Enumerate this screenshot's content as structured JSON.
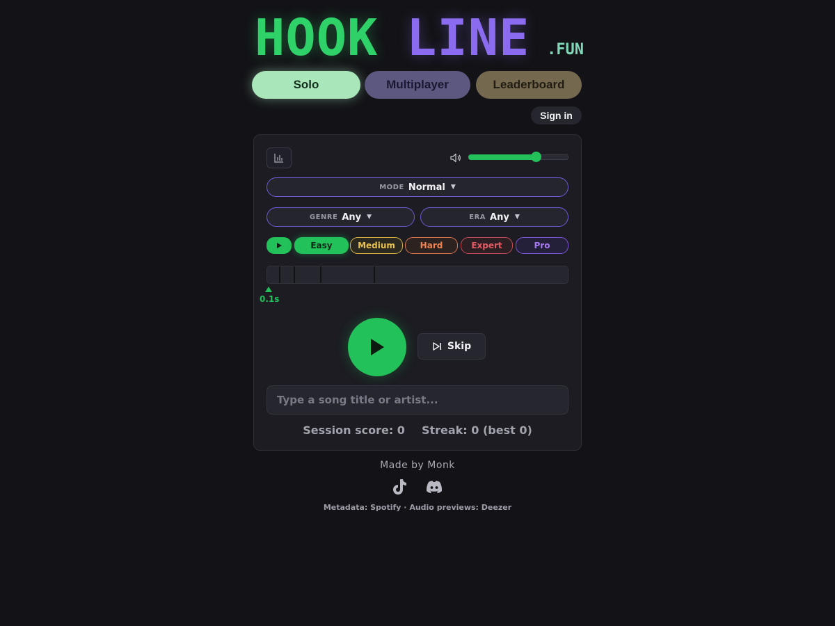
{
  "logo": {
    "part1": "HOOK",
    "part2": "LINE",
    "suffix": ".FUN"
  },
  "nav": {
    "solo": "Solo",
    "multiplayer": "Multiplayer",
    "leaderboard": "Leaderboard"
  },
  "auth": {
    "sign_in": "Sign in"
  },
  "player": {
    "stats_icon": "bar-chart-icon",
    "volume_icon": "speaker-icon",
    "volume_level": 0.68
  },
  "mode": {
    "label": "MODE",
    "value": "Normal"
  },
  "genre": {
    "label": "GENRE",
    "value": "Any"
  },
  "era": {
    "label": "ERA",
    "value": "Any"
  },
  "difficulty": {
    "preview_icon": "play-icon",
    "options": [
      "Easy",
      "Medium",
      "Hard",
      "Expert",
      "Pro"
    ],
    "selected": "Easy"
  },
  "timeline": {
    "marker_label": "0.1s",
    "segments_s": [
      0.1,
      0.5,
      2,
      8,
      16
    ]
  },
  "controls": {
    "play_icon": "play-icon",
    "skip_label": "Skip",
    "skip_icon": "skip-forward-icon"
  },
  "guess": {
    "placeholder": "Type a song title or artist..."
  },
  "score": {
    "session": "Session score: 0",
    "streak": "Streak: 0 (best 0)"
  },
  "footer": {
    "made_by": "Made by Monk",
    "tiktok_icon": "tiktok-icon",
    "discord_icon": "discord-icon",
    "credits": "Metadata: Spotify · Audio previews: Deezer"
  },
  "colors": {
    "background": "#131317",
    "accent_green": "#22c15a",
    "accent_purple": "#8b6cf0",
    "medium": "#e9c24d",
    "hard": "#ef8450",
    "expert": "#e25a62",
    "pro": "#a77cf2"
  }
}
